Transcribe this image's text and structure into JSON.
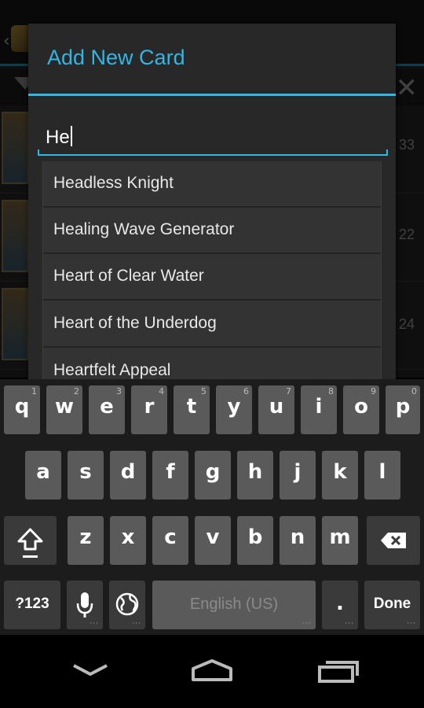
{
  "background_list": {
    "counts": [
      "33",
      "22",
      "24"
    ]
  },
  "dialog": {
    "title": "Add New Card",
    "input_value": "He"
  },
  "suggestions": [
    "Headless Knight",
    "Healing Wave Generator",
    "Heart of Clear Water",
    "Heart of the Underdog",
    "Heartfelt Appeal"
  ],
  "keyboard": {
    "row1": [
      {
        "k": "q",
        "h": "1"
      },
      {
        "k": "w",
        "h": "2"
      },
      {
        "k": "e",
        "h": "3"
      },
      {
        "k": "r",
        "h": "4"
      },
      {
        "k": "t",
        "h": "5"
      },
      {
        "k": "y",
        "h": "6"
      },
      {
        "k": "u",
        "h": "7"
      },
      {
        "k": "i",
        "h": "8"
      },
      {
        "k": "o",
        "h": "9"
      },
      {
        "k": "p",
        "h": "0"
      }
    ],
    "row2": [
      "a",
      "s",
      "d",
      "f",
      "g",
      "h",
      "j",
      "k",
      "l"
    ],
    "row3": [
      "z",
      "x",
      "c",
      "v",
      "b",
      "n",
      "m"
    ],
    "symbols_label": "?123",
    "space_label": "English (US)",
    "period_label": ".",
    "done_label": "Done"
  },
  "colors": {
    "accent": "#33b5e5",
    "key": "#5a5a5a",
    "key_dark": "#3a3a3a"
  },
  "icons": [
    "shift-icon",
    "backspace-icon",
    "mic-icon",
    "globe-icon",
    "nav-back-icon",
    "nav-home-icon",
    "nav-recents-icon"
  ]
}
